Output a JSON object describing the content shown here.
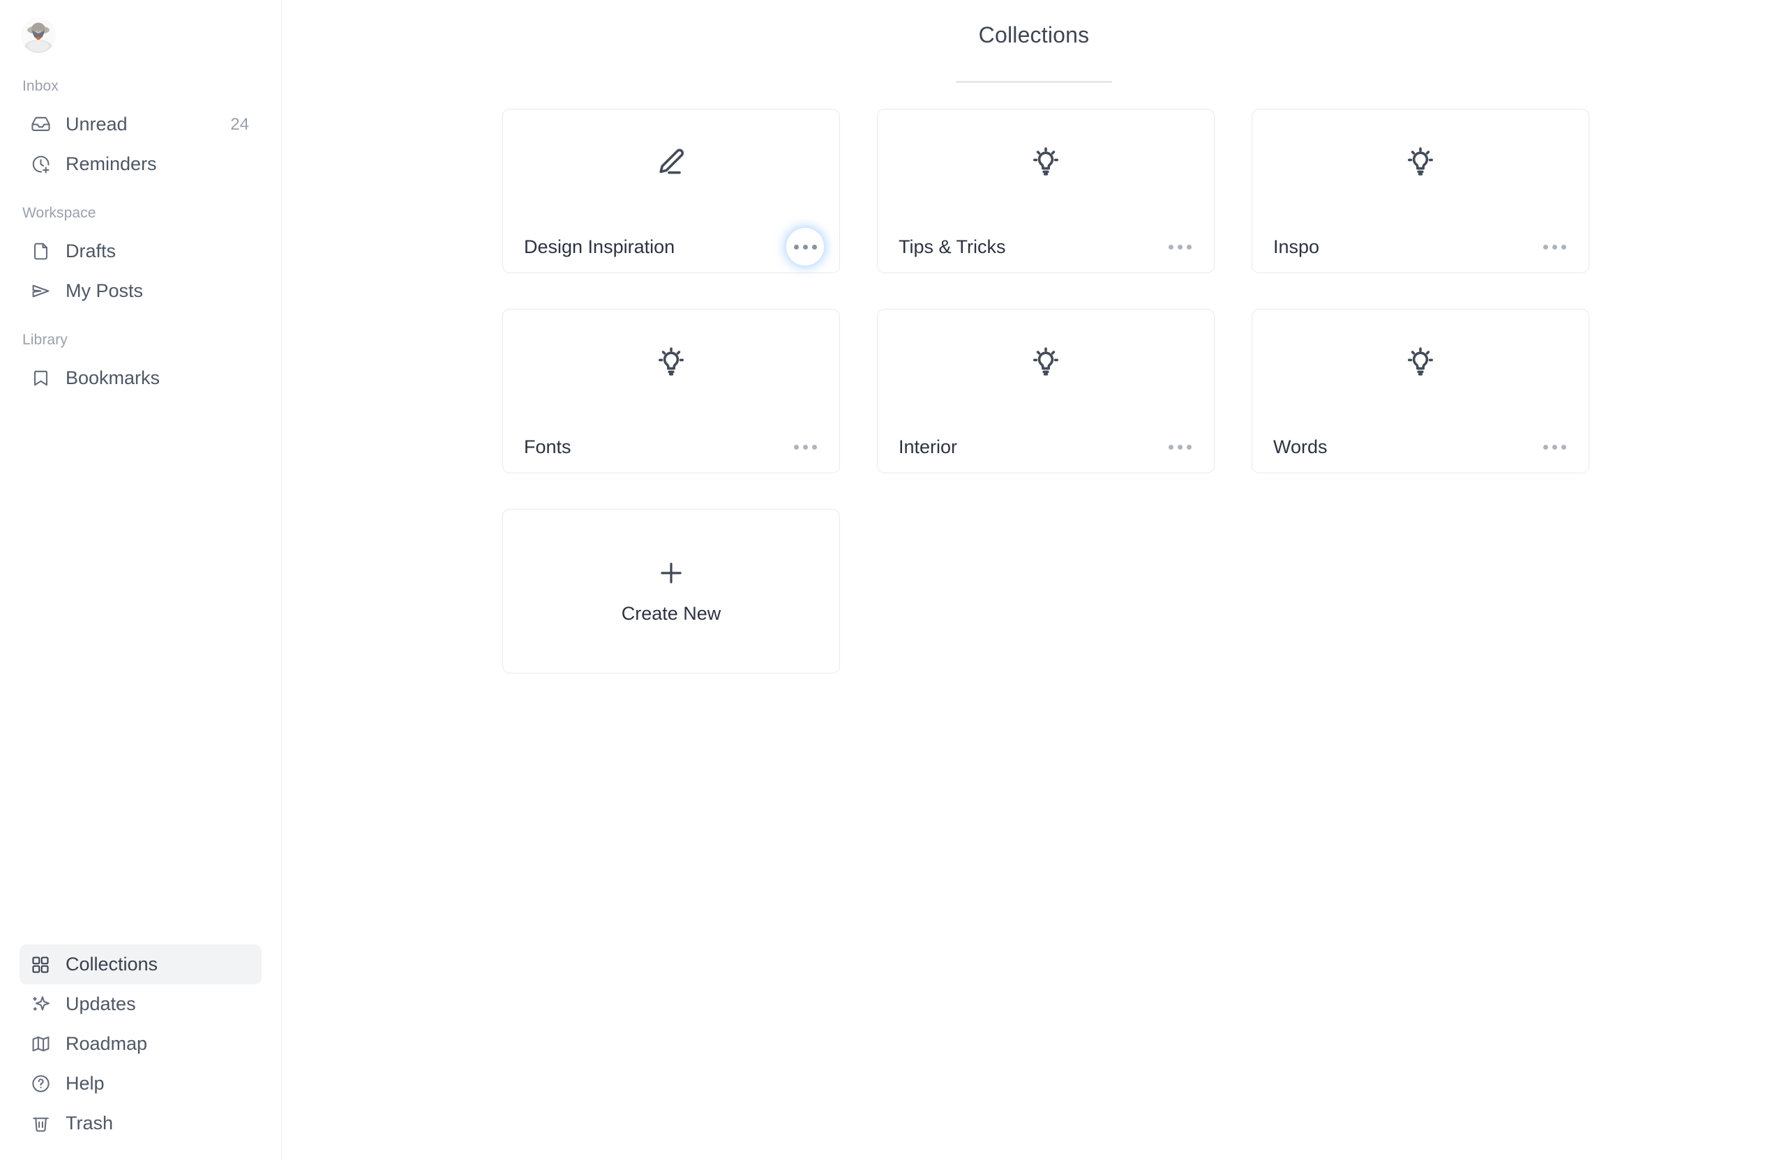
{
  "sidebar": {
    "avatar": {
      "icon": "user-avatar-photo",
      "alt": "User avatar"
    },
    "sections": [
      {
        "label": "Inbox",
        "items": [
          {
            "label": "Unread",
            "icon": "inbox-icon",
            "count": "24"
          },
          {
            "label": "Reminders",
            "icon": "clock-plus-icon",
            "count": ""
          }
        ]
      },
      {
        "label": "Workspace",
        "items": [
          {
            "label": "Drafts",
            "icon": "file-icon",
            "count": ""
          },
          {
            "label": "My Posts",
            "icon": "send-icon",
            "count": ""
          }
        ]
      },
      {
        "label": "Library",
        "items": [
          {
            "label": "Bookmarks",
            "icon": "bookmark-icon",
            "count": ""
          }
        ]
      }
    ],
    "bottom_items": [
      {
        "label": "Collections",
        "icon": "grid-icon",
        "active": true
      },
      {
        "label": "Updates",
        "icon": "sparkles-icon",
        "active": false
      },
      {
        "label": "Roadmap",
        "icon": "map-icon",
        "active": false
      },
      {
        "label": "Help",
        "icon": "question-circle-icon",
        "active": false
      },
      {
        "label": "Trash",
        "icon": "trash-icon",
        "active": false
      }
    ]
  },
  "main": {
    "title": "Collections",
    "cards": [
      {
        "title": "Design Inspiration",
        "icon": "pencil-icon",
        "menu_focused": true
      },
      {
        "title": "Tips & Tricks",
        "icon": "lightbulb-icon",
        "menu_focused": false
      },
      {
        "title": "Inspo",
        "icon": "lightbulb-icon",
        "menu_focused": false
      },
      {
        "title": "Fonts",
        "icon": "lightbulb-icon",
        "menu_focused": false
      },
      {
        "title": "Interior",
        "icon": "lightbulb-icon",
        "menu_focused": false
      },
      {
        "title": "Words",
        "icon": "lightbulb-icon",
        "menu_focused": false
      }
    ],
    "create_card": {
      "label": "Create New",
      "icon": "plus-icon"
    }
  },
  "colors": {
    "accent_focus_ring": "#78b4ff",
    "sidebar_active_bg": "#f1f3f5",
    "card_border": "#e8e9ee",
    "text_primary": "#2c3340",
    "text_secondary": "#5b6471",
    "text_muted": "#9aa1ac"
  }
}
